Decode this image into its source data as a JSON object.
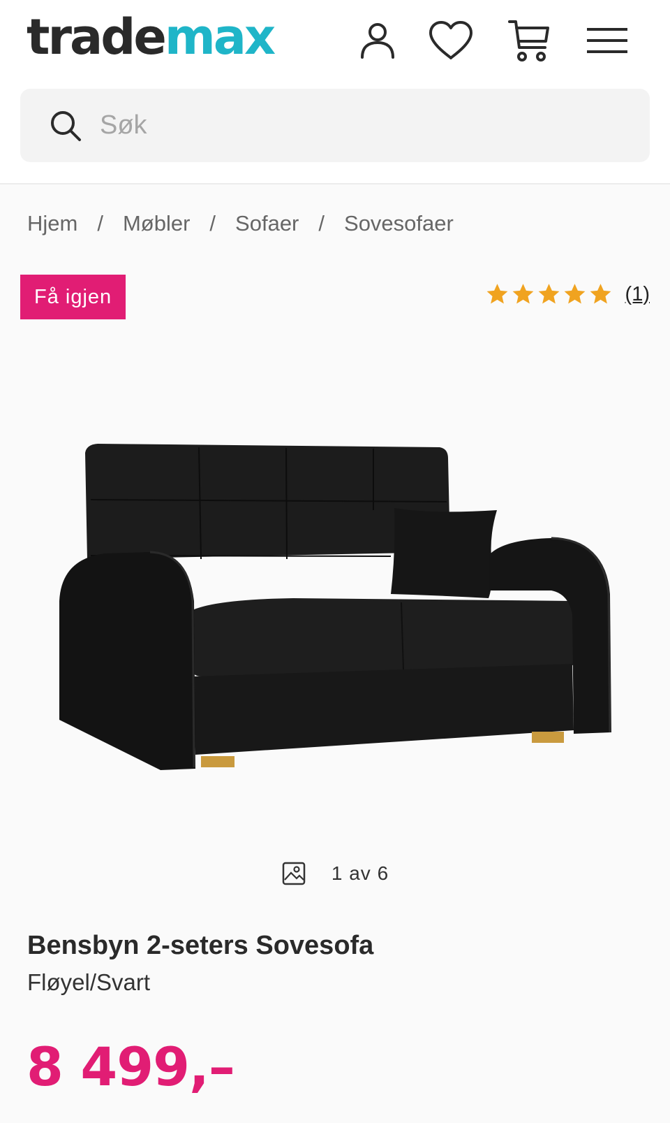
{
  "header": {
    "logo": {
      "part1": "trade",
      "part2": "max"
    },
    "icons": [
      "user-icon",
      "heart-icon",
      "cart-icon",
      "menu-icon"
    ]
  },
  "search": {
    "placeholder": "Søk",
    "value": ""
  },
  "breadcrumb": {
    "items": [
      "Hjem",
      "Møbler",
      "Sofaer",
      "Sovesofaer"
    ],
    "separator": "/"
  },
  "badge": {
    "label": "Få igjen",
    "color": "#e11d74"
  },
  "rating": {
    "stars": 5,
    "count_label": "(1)",
    "star_color": "#f0a320"
  },
  "gallery": {
    "counter": "1 av 6"
  },
  "product": {
    "title": "Bensbyn 2-seters Sovesofa",
    "variant": "Fløyel/Svart",
    "price": "8 499,–",
    "price_color": "#e11d74"
  },
  "colors": {
    "brand_dark": "#2a2a2a",
    "brand_teal": "#1fb5c8",
    "accent": "#e11d74"
  }
}
